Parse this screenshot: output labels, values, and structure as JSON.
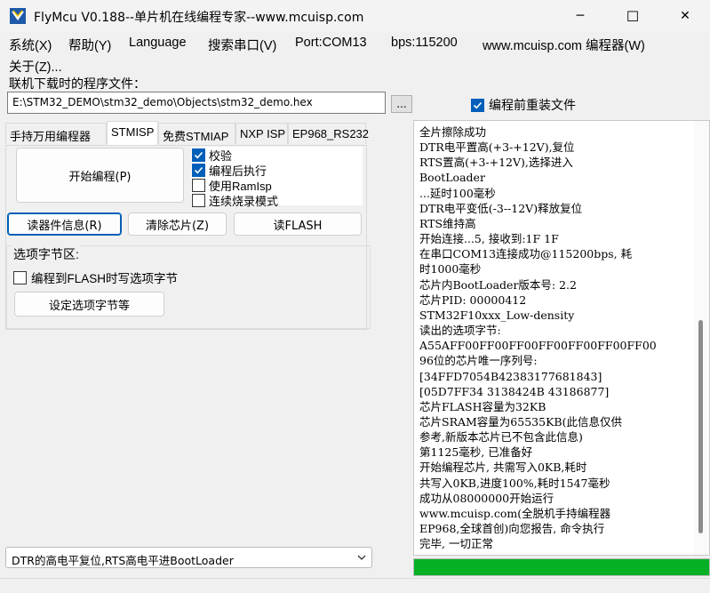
{
  "window": {
    "title": "FlyMcu V0.188--单片机在线编程专家--www.mcuisp.com",
    "minimize_glyph": "─",
    "maximize_glyph": "☐",
    "close_glyph": "✕"
  },
  "menu": {
    "items": [
      "系统(X)",
      "帮助(Y)",
      "Language",
      "搜索串口(V)",
      "Port:COM13",
      "bps:115200",
      "www.mcuisp.com 编程器(W)",
      "关于(Z)..."
    ]
  },
  "file": {
    "label": "联机下载时的程序文件：",
    "path": "E:\\STM32_DEMO\\stm32_demo\\Objects\\stm32_demo.hex",
    "browse_label": "...",
    "reload_label": "编程前重装文件",
    "reload_checked": true
  },
  "tabs": [
    {
      "label": "手持万用编程器",
      "active": false
    },
    {
      "label": "STMISP",
      "active": true
    },
    {
      "label": "免费STMIAP",
      "active": false
    },
    {
      "label": "NXP ISP",
      "active": false
    },
    {
      "label": "EP968_RS232",
      "active": false
    }
  ],
  "stmisp": {
    "start_button": "开始编程(P)",
    "options": [
      {
        "label": "校验",
        "checked": true
      },
      {
        "label": "编程后执行",
        "checked": true
      },
      {
        "label": "使用RamIsp",
        "checked": false
      },
      {
        "label": "连续烧录模式",
        "checked": false
      }
    ],
    "read_info_button": "读器件信息(R)",
    "erase_button": "清除芯片(Z)",
    "read_flash_button": "读FLASH",
    "option_group_title": "选项字节区:",
    "option_write_label": "编程到FLASH时写选项字节",
    "option_write_checked": false,
    "set_option_button": "设定选项字节等"
  },
  "log": {
    "lines": [
      "全片擦除成功",
      "DTR电平置高(+3-+12V),复位",
      "RTS置高(+3-+12V),选择进入",
      "BootLoader",
      "...延时100毫秒",
      "DTR电平变低(-3--12V)释放复位",
      "RTS维持高",
      "开始连接...5, 接收到:1F 1F",
      "在串口COM13连接成功@115200bps, 耗",
      "时1000毫秒",
      "芯片内BootLoader版本号: 2.2",
      "芯片PID: 00000412",
      "STM32F10xxx_Low-density",
      "读出的选项字节:",
      "A55AFF00FF00FF00FF00FF00FF00FF00",
      "96位的芯片唯一序列号:",
      "[34FFD7054B42383177681843]",
      "[05D7FF34 3138424B 43186877]",
      "芯片FLASH容量为32KB",
      "芯片SRAM容量为65535KB(此信息仅供",
      "参考,新版本芯片已不包含此信息)",
      "第1125毫秒, 已准备好",
      "开始编程芯片, 共需写入0KB,耗时",
      "共写入0KB,进度100%,耗时1547毫秒",
      "成功从08000000开始运行",
      "www.mcuisp.com(全脱机手持编程器",
      "EP968,全球首创)向您报告, 命令执行",
      "完毕, 一切正常"
    ]
  },
  "progress": {
    "value": 1.0,
    "color": "#06b025"
  },
  "reset_mode": {
    "selected": "DTR的高电平复位,RTS高电平进BootLoader"
  },
  "colors": {
    "accent": "#005fb8"
  }
}
